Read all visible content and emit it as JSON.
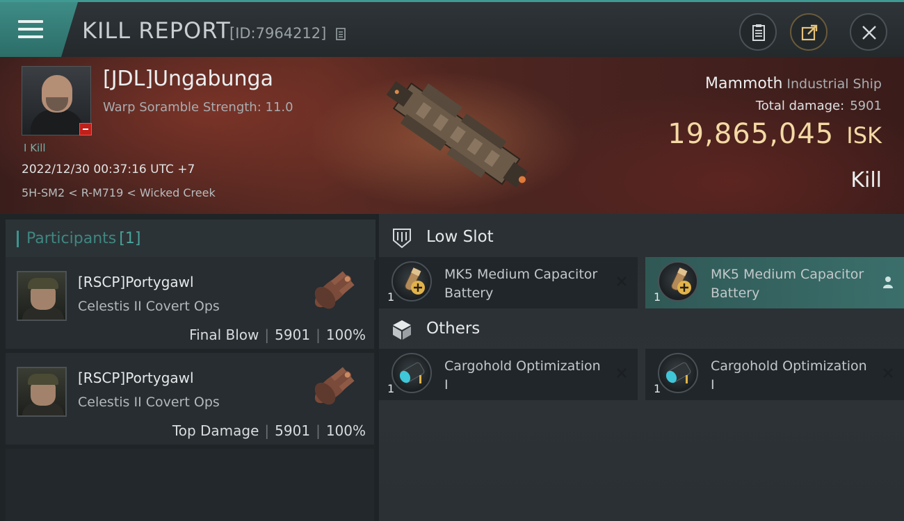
{
  "header": {
    "title": "KILL REPORT",
    "report_id": "[ID:7964212]",
    "icons": [
      "menu-icon",
      "clipboard-icon",
      "share-icon",
      "close-icon"
    ]
  },
  "victim": {
    "name": "[JDL]Ungabunga",
    "warp_scramble": "Warp Soramble Strength: 11.0",
    "kill_label": "I Kill",
    "timestamp": "2022/12/30 00:37:16 UTC +7",
    "location": "5H-SM2 < R-M719 < Wicked Creek"
  },
  "ship": {
    "name": "Mammoth",
    "class": "Industrial Ship",
    "total_damage_label": "Total damage:",
    "total_damage": "5901",
    "isk_value": "19,865,045",
    "isk_unit": "ISK",
    "result": "Kill"
  },
  "participants": {
    "title": "Participants",
    "count": "[1]",
    "rows": [
      {
        "name": "[RSCP]Portygawl",
        "ship": "Celestis II Covert Ops",
        "role": "Final Blow",
        "damage": "5901",
        "percent": "100%"
      },
      {
        "name": "[RSCP]Portygawl",
        "ship": "Celestis II Covert Ops",
        "role": "Top Damage",
        "damage": "5901",
        "percent": "100%"
      }
    ]
  },
  "sections": {
    "low_slot": {
      "title": "Low Slot",
      "items": [
        {
          "qty": "1",
          "name": "MK5 Medium Capacitor Battery",
          "status": "destroyed"
        },
        {
          "qty": "1",
          "name": "MK5 Medium Capacitor Battery",
          "status": "dropped"
        }
      ]
    },
    "others": {
      "title": "Others",
      "items": [
        {
          "qty": "1",
          "name": "Cargohold Optimization I",
          "status": "destroyed"
        },
        {
          "qty": "1",
          "name": "Cargohold Optimization I",
          "status": "destroyed"
        }
      ]
    }
  },
  "colors": {
    "accent": "#3f9a93",
    "isk": "#f3d9a4",
    "highlight": "#3b6f6b"
  }
}
